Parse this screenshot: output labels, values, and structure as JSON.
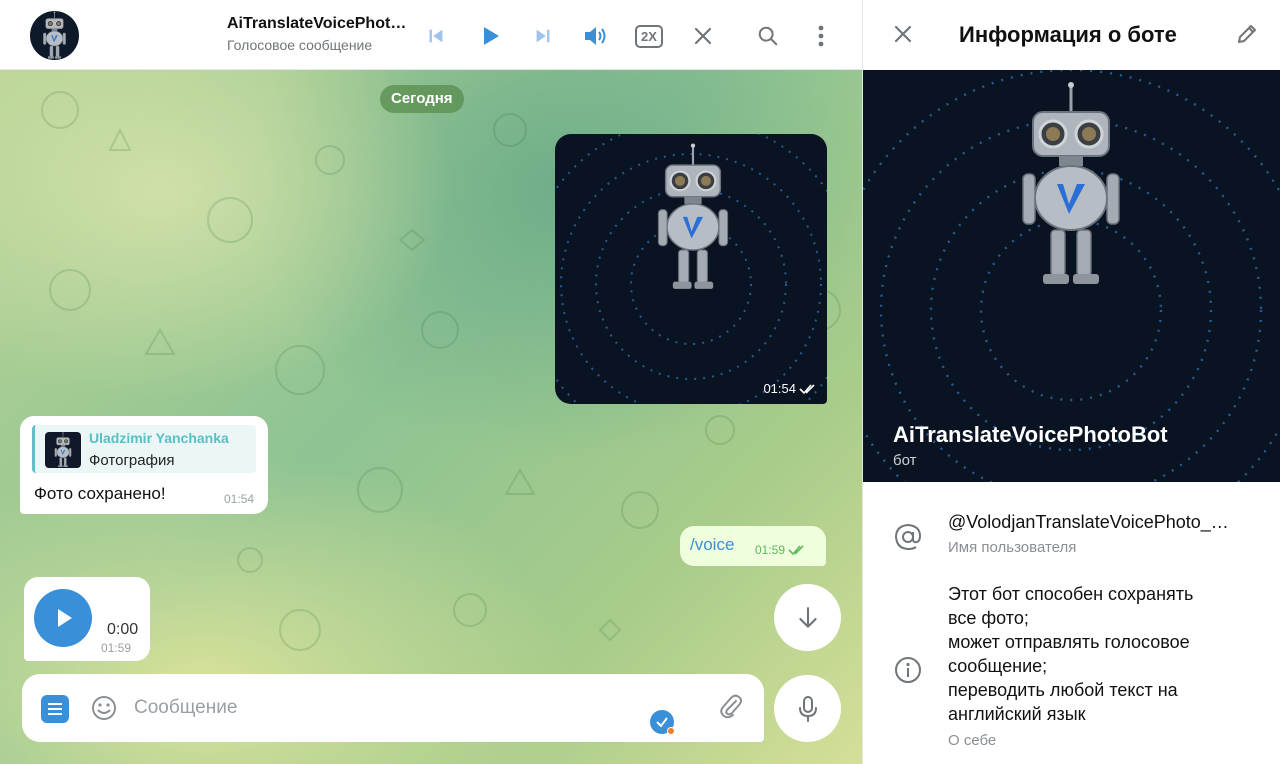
{
  "header": {
    "title": "AiTranslateVoicePhoto…",
    "subtitle": "Голосовое сообщение",
    "speed_label": "2X",
    "icons": [
      "skip-previous-icon",
      "play-icon",
      "skip-next-icon",
      "volume-icon",
      "speed-icon",
      "close-icon",
      "search-icon",
      "more-vert-icon"
    ]
  },
  "chat": {
    "date_chip": "Сегодня",
    "photo_message": {
      "time": "01:54",
      "status": "read"
    },
    "reply_message": {
      "reply_name": "Uladzimir Yanchanka",
      "reply_kind": "Фотография",
      "text": "Фото сохранено!",
      "time": "01:54"
    },
    "command_message": {
      "text": "/voice",
      "time": "01:59",
      "status": "read"
    },
    "voice_message": {
      "duration": "0:00",
      "time": "01:59"
    },
    "composer": {
      "placeholder": "Сообщение"
    }
  },
  "panel": {
    "title": "Информация о боте",
    "bot_name": "AiTranslateVoicePhotoBot",
    "bot_type": "бот",
    "username": "@VolodjanTranslateVoicePhoto_…",
    "username_label": "Имя пользователя",
    "about": "Этот бот способен сохранять\nвсе фото;\nможет отправлять голосовое\nсообщение;\nпереводить любой текст на\nанглийский язык",
    "about_label": "О себе"
  },
  "colors": {
    "accent": "#3a8fd9",
    "outgoing_bubble": "#effedd",
    "read_check": "#5fb85b"
  }
}
